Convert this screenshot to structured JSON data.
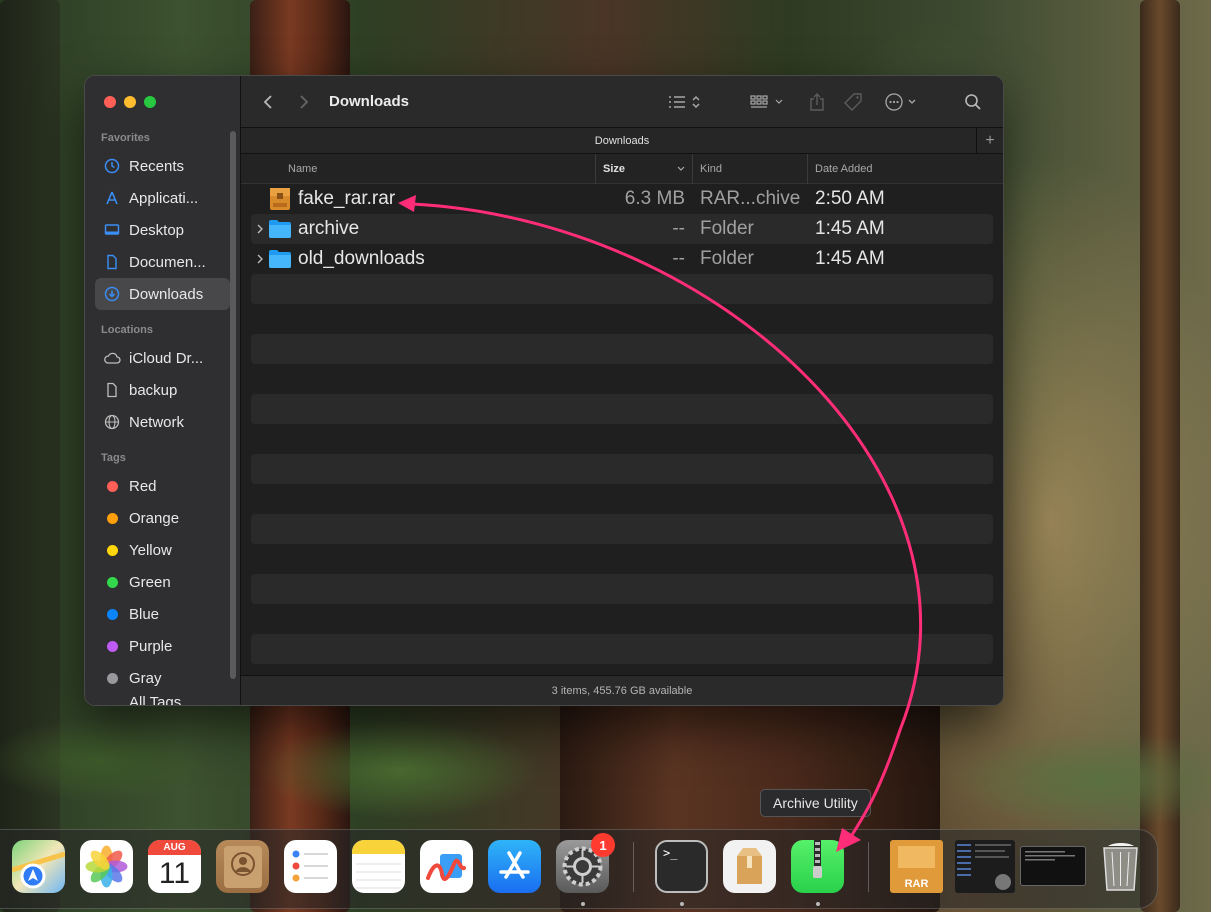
{
  "window": {
    "title": "Downloads",
    "tab_label": "Downloads",
    "status": "3 items, 455.76 GB available"
  },
  "sidebar": {
    "favorites_header": "Favorites",
    "favorites": [
      {
        "label": "Recents",
        "icon": "clock-icon"
      },
      {
        "label": "Applicati...",
        "icon": "applications-icon"
      },
      {
        "label": "Desktop",
        "icon": "desktop-icon"
      },
      {
        "label": "Documen...",
        "icon": "document-icon"
      },
      {
        "label": "Downloads",
        "icon": "download-icon",
        "selected": true
      }
    ],
    "locations_header": "Locations",
    "locations": [
      {
        "label": "iCloud Dr...",
        "icon": "cloud-icon"
      },
      {
        "label": "backup",
        "icon": "file-icon"
      },
      {
        "label": "Network",
        "icon": "globe-icon"
      }
    ],
    "tags_header": "Tags",
    "tags": [
      {
        "label": "Red",
        "color": "#ff5f57"
      },
      {
        "label": "Orange",
        "color": "#ff9f0a"
      },
      {
        "label": "Yellow",
        "color": "#ffd60a"
      },
      {
        "label": "Green",
        "color": "#32d74b"
      },
      {
        "label": "Blue",
        "color": "#0a84ff"
      },
      {
        "label": "Purple",
        "color": "#bf5af2"
      },
      {
        "label": "Gray",
        "color": "#98989d"
      }
    ],
    "all_tags": "All Tags..."
  },
  "columns": {
    "name": "Name",
    "size": "Size",
    "kind": "Kind",
    "date_added": "Date Added"
  },
  "files": [
    {
      "name": "fake_rar.rar",
      "size": "6.3 MB",
      "kind": "RAR...chive",
      "date": "2:50 AM",
      "type": "rar"
    },
    {
      "name": "archive",
      "size": "--",
      "kind": "Folder",
      "date": "1:45 AM",
      "type": "folder"
    },
    {
      "name": "old_downloads",
      "size": "--",
      "kind": "Folder",
      "date": "1:45 AM",
      "type": "folder"
    }
  ],
  "dock": {
    "tooltip": "Archive Utility",
    "calendar_month": "AUG",
    "calendar_day": "11",
    "settings_badge": "1",
    "terminal_prompt": ">_",
    "rar_label": "RAR",
    "apps": [
      "maps-icon",
      "photos-icon",
      "calendar-icon",
      "contacts-icon",
      "reminders-icon",
      "notes-icon",
      "freeform-icon",
      "app-store-icon",
      "system-settings-icon",
      "terminal-icon",
      "unarchiver-icon",
      "archive-utility-icon",
      "rar-file-icon",
      "screenshot-thumbnail-icon",
      "terminal-window-thumbnail-icon",
      "trash-icon"
    ]
  },
  "colors": {
    "accent": "#0a84ff",
    "arrow": "#ff2d78",
    "archive_utility_green": "#3ee45a"
  }
}
